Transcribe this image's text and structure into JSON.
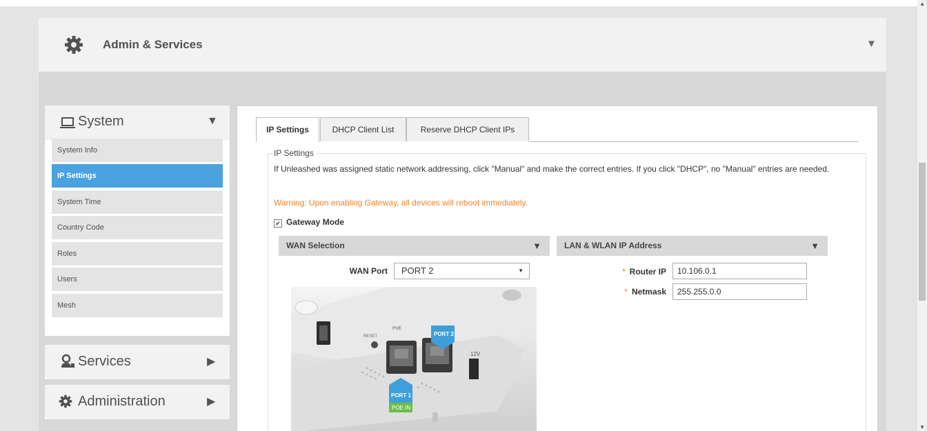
{
  "header": {
    "title": "Admin & Services",
    "gear_icon": "gear-icon",
    "collapse_icon": "triangle-down-icon"
  },
  "sidebar": {
    "system": {
      "label": "System",
      "icon": "laptop-icon",
      "arrow": "triangle-down-icon"
    },
    "items": [
      {
        "label": "System Info",
        "active": false
      },
      {
        "label": "IP Settings",
        "active": true
      },
      {
        "label": "System Time",
        "active": false
      },
      {
        "label": "Country Code",
        "active": false
      },
      {
        "label": "Roles",
        "active": false
      },
      {
        "label": "Users",
        "active": false
      },
      {
        "label": "Mesh",
        "active": false
      }
    ],
    "services": {
      "label": "Services",
      "icon": "services-icon",
      "arrow": "triangle-right-icon"
    },
    "administration": {
      "label": "Administration",
      "icon": "gear-icon",
      "arrow": "triangle-right-icon"
    }
  },
  "tabs": [
    {
      "label": "IP Settings",
      "active": true
    },
    {
      "label": "DHCP Client List",
      "active": false
    },
    {
      "label": "Reserve DHCP Client IPs",
      "active": false
    }
  ],
  "ip_settings": {
    "legend": "IP Settings",
    "description": "If Unleashed was assigned static network addressing, click \"Manual\" and make the correct entries. If you click \"DHCP\", no \"Manual\" entries are needed.",
    "warning": "Warning: Upon enabling Gateway, all devices will reboot immediately.",
    "gateway_label": "Gateway Mode",
    "gateway_checked": true,
    "wan_section": "WAN Selection",
    "lan_section": "LAN & WLAN IP Address",
    "wan_port_label": "WAN Port",
    "wan_port_value": "PORT 2",
    "router_ip_label": "Router IP",
    "router_ip_value": "10.106.0.1",
    "netmask_label": "Netmask",
    "netmask_value": "255.255.0.0",
    "required_mark": "*"
  },
  "device_image": {
    "port1_label": "PORT 1",
    "poe_in_label": "POE IN",
    "port2_label": "PORT 2",
    "reset_label": "RESET",
    "poe_label": "PoE",
    "volt_label": "12V"
  },
  "colors": {
    "accent": "#4aa3df",
    "warning": "#f4822a",
    "poe_green": "#6cbf4a"
  }
}
